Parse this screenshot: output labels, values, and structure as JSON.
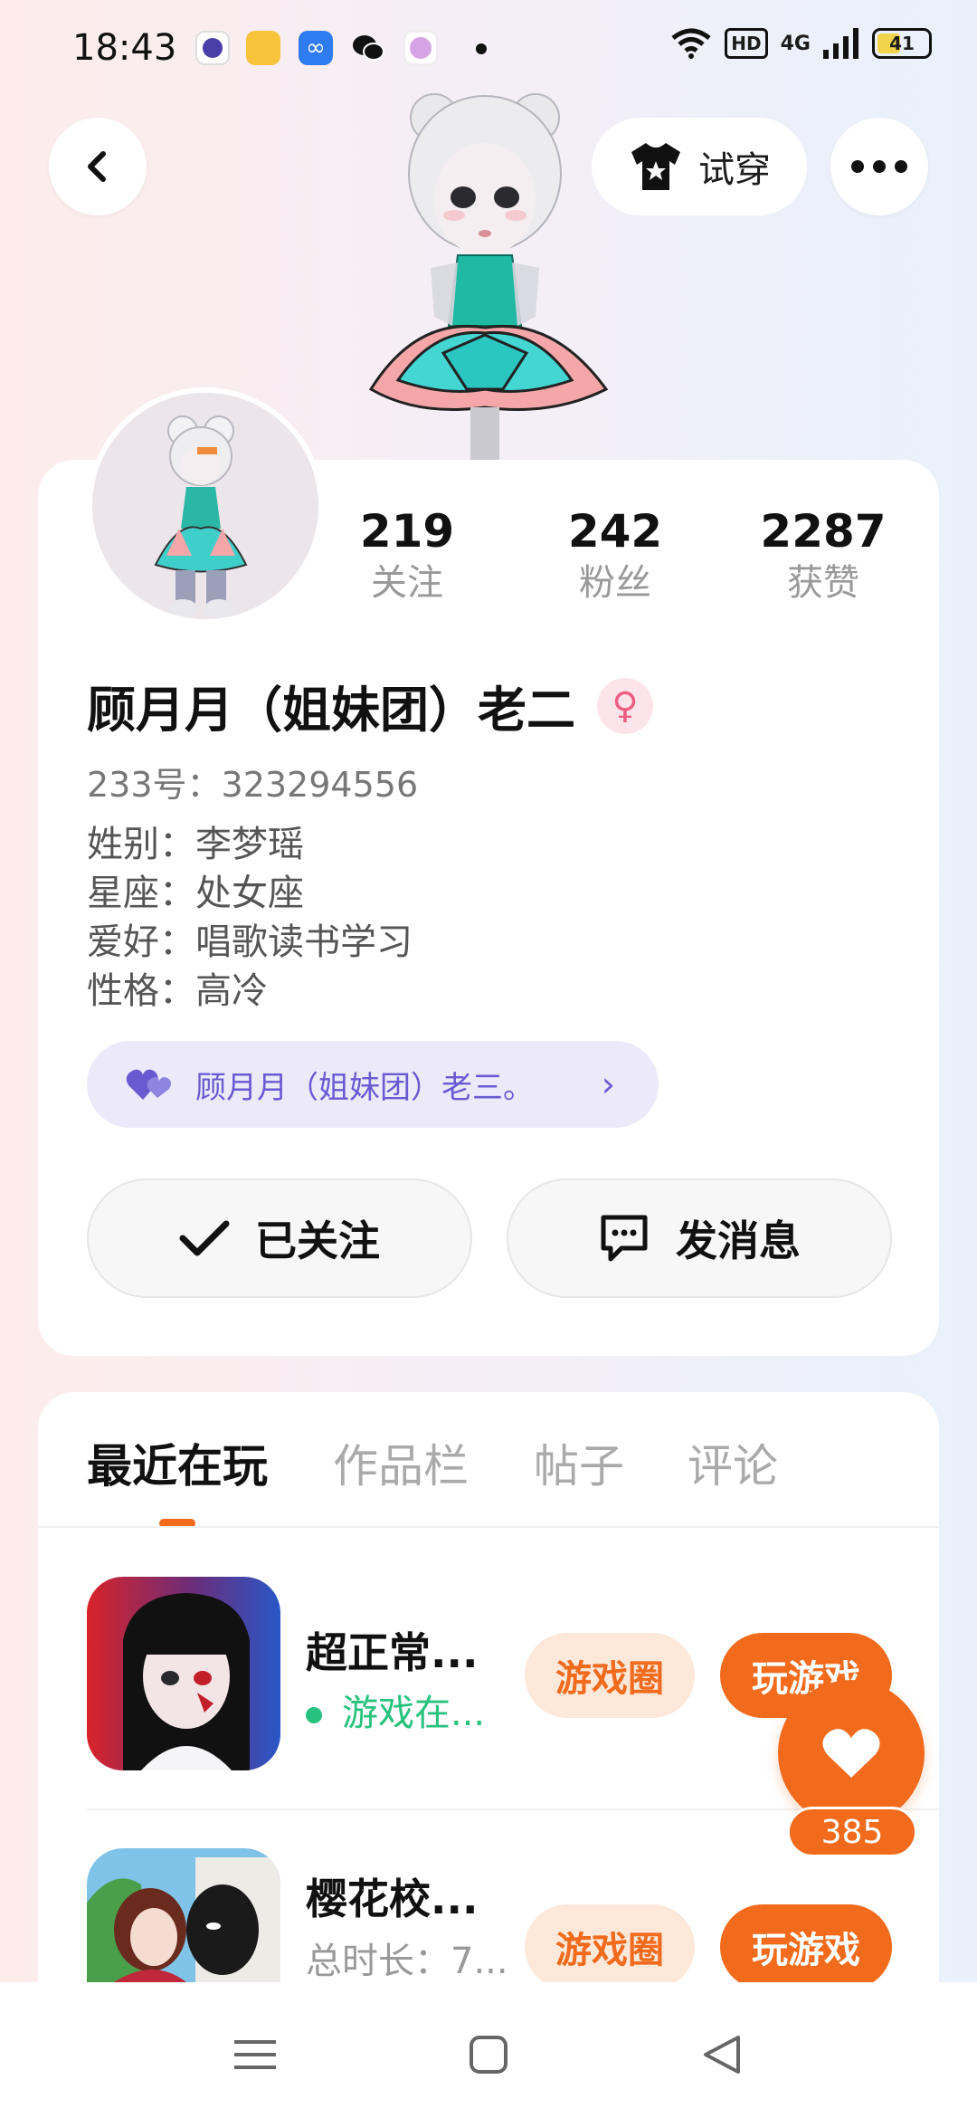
{
  "status_bar": {
    "time": "18:43",
    "network": "HD",
    "signal": "4G",
    "battery": "41",
    "battery_level": 0.41
  },
  "header": {
    "back_icon": "chevron-left-icon",
    "tryon_label": "试穿",
    "tryon_icon": "shirt-star-icon",
    "more_icon": "more-horizontal-icon"
  },
  "profile": {
    "name": "顾月月（姐妹团）老二",
    "gender_icon": "female-icon",
    "uid": "233号：323294556",
    "stats": [
      {
        "value": "219",
        "label": "关注"
      },
      {
        "value": "242",
        "label": "粉丝"
      },
      {
        "value": "2287",
        "label": "获赞"
      }
    ],
    "bio": [
      "姓别：李梦瑶",
      "星座：处女座",
      "爱好：唱歌读书学习",
      "性格：高冷"
    ],
    "relation": {
      "label": "顾月月（姐妹团）老三。",
      "icon": "hearts-icon"
    },
    "follow_label": "已关注",
    "message_label": "发消息"
  },
  "tabs": [
    {
      "label": "最近在玩",
      "active": true
    },
    {
      "label": "作品栏",
      "active": false
    },
    {
      "label": "帖子",
      "active": false
    },
    {
      "label": "评论",
      "active": false
    }
  ],
  "games": [
    {
      "title": "超正常...",
      "sub": "游戏在...",
      "sub_color": "#27c27d",
      "circle_label": "游戏圈",
      "play_label": "玩游戏",
      "online": true
    },
    {
      "title": "樱花校...",
      "sub": "总时长：7...",
      "sub_color": "#999999",
      "circle_label": "游戏圈",
      "play_label": "玩游戏",
      "online": false
    }
  ],
  "like": {
    "count": "385"
  },
  "colors": {
    "accent": "#f26b1d",
    "relation_bg": "#ece9fb",
    "relation_text": "#6a5ad1"
  }
}
